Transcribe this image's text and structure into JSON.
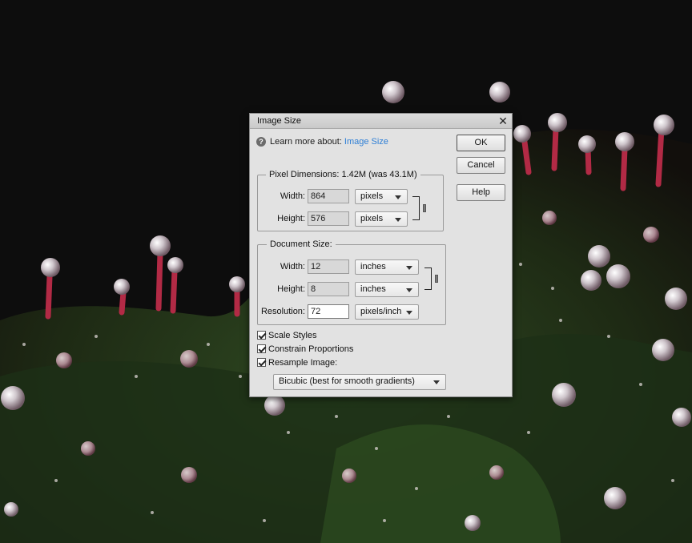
{
  "dialog": {
    "title": "Image Size",
    "close_icon": "close-icon",
    "help_icon": "question-mark-icon",
    "help_prefix": "Learn more about:",
    "help_link": "Image Size",
    "buttons": {
      "ok": "OK",
      "cancel": "Cancel",
      "help": "Help"
    }
  },
  "pixel_dimensions": {
    "legend": "Pixel Dimensions:  1.42M (was 43.1M)",
    "width_label": "Width:",
    "width_value": "864",
    "width_unit": "pixels",
    "height_label": "Height:",
    "height_value": "576",
    "height_unit": "pixels"
  },
  "document_size": {
    "legend": "Document Size:",
    "width_label": "Width:",
    "width_value": "12",
    "width_unit": "inches",
    "height_label": "Height:",
    "height_value": "8",
    "height_unit": "inches",
    "resolution_label": "Resolution:",
    "resolution_value": "72",
    "resolution_unit": "pixels/inch"
  },
  "options": {
    "scale_styles": "Scale Styles",
    "scale_styles_checked": true,
    "constrain_proportions": "Constrain Proportions",
    "constrain_proportions_checked": true,
    "resample_image": "Resample Image:",
    "resample_image_checked": true,
    "resample_method": "Bicubic (best for smooth gradients)"
  },
  "colors": {
    "dialog_bg": "#e2e2e2",
    "link": "#2e7fd6",
    "photo_bg": "#0d0d0d"
  }
}
